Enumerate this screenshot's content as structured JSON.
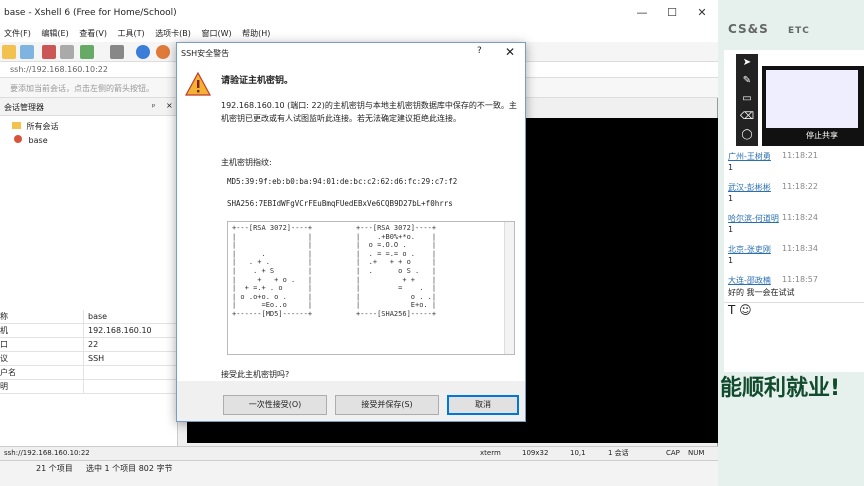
{
  "window": {
    "title": "base - Xshell 6 (Free for Home/School)"
  },
  "menu": [
    "文件(F)",
    "编辑(E)",
    "查看(V)",
    "工具(T)",
    "选项卡(B)",
    "窗口(W)",
    "帮助(H)"
  ],
  "address": "ssh://192.168.160.10:22",
  "hint": "要添加当前会话，点击左侧的箭头按钮。",
  "session_manager": {
    "title": "会话管理器",
    "pin": "ᵖ",
    "close": "×",
    "tree": [
      {
        "label": "所有会话"
      },
      {
        "label": "base"
      }
    ]
  },
  "properties": [
    {
      "key": "称",
      "value": "base"
    },
    {
      "key": "机",
      "value": "192.168.160.10"
    },
    {
      "key": "口",
      "value": "22"
    },
    {
      "key": "议",
      "value": "SSH"
    },
    {
      "key": "户名",
      "value": ""
    },
    {
      "key": "明",
      "value": ""
    }
  ],
  "status": {
    "address": "ssh://192.168.160.10:22",
    "term": "xterm",
    "size": "109x32",
    "pos": "10,1",
    "sessions": "1 会话",
    "cap": "CAP",
    "num": "NUM"
  },
  "explorer": {
    "items": "21 个项目",
    "selected": "选中 1 个项目  802 字节"
  },
  "dialog": {
    "title": "SSH安全警告",
    "help": "?",
    "close": "✕",
    "heading": "请验证主机密钥。",
    "paragraph": "192.168.160.10 (端口: 22)的主机密钥与本地主机密钥数据库中保存的不一致。主机密钥已更改或有人试图监听此连接。若无法确定建议拒绝此连接。",
    "fingerprint_label": "主机密钥指纹:",
    "md5": "MD5:39:9f:eb:b0:ba:94:01:de:bc:c2:62:d6:fc:29:c7:f2",
    "sha256": "SHA256:7EBIdWFgVCrFEuBmqFUedEBxVe6CQB9D27bL+f0hrrs",
    "art_md5": "+---[RSA 3072]----+\n|                 |\n|                 |\n|      .          |\n|   . + .         |\n|    . + S        |\n|     +   + o .   |\n|  + =.+ . o      |\n| o .o+o. o .     |\n|      =Eo..o     |\n+------[MD5]------+",
    "art_sha": "+---[RSA 3072]----+\n|    .+B0%+*o.    |\n|  o =.O.O .      |\n|  . = =.= o .    |\n|  .+   + + o     |\n|  .      o S .   |\n|          + +    |\n|         =    .  |\n|            o . .|\n|            E+o. |\n+----[SHA256]-----+",
    "accept_question": "接受此主机密钥吗?",
    "buttons": {
      "once": "一次性接受(O)",
      "save": "接受并保存(S)",
      "cancel": "取消"
    }
  },
  "side_panel": {
    "logo": "CS&S",
    "logo_right": "ETC",
    "stop_share": "停止共享",
    "messages": [
      {
        "name": "广州-王树勇",
        "time": "11:18:21",
        "text": "1"
      },
      {
        "name": "武汉-彭彬彬",
        "time": "11:18:22",
        "text": "1"
      },
      {
        "name": "哈尔滨-何道明",
        "time": "11:18:24",
        "text": "1"
      },
      {
        "name": "北京-张吏刚",
        "time": "11:18:34",
        "text": "1"
      },
      {
        "name": "大连-邵政楠",
        "time": "11:18:57",
        "text": "好的 我一会在试试"
      }
    ],
    "input_icons": "T ☺",
    "banner": "能顺利就业!"
  }
}
